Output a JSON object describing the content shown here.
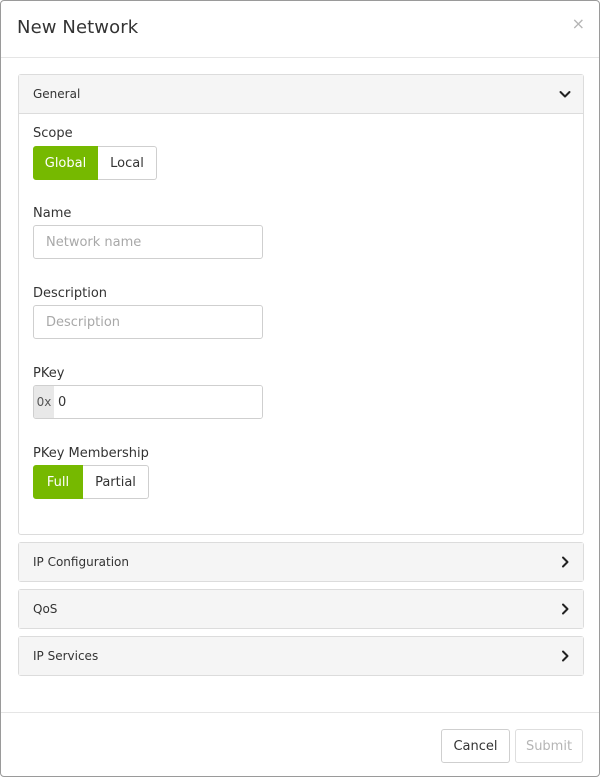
{
  "dialog": {
    "title": "New Network",
    "close_symbol": "×"
  },
  "general": {
    "title": "General",
    "expanded": true,
    "scope": {
      "label": "Scope",
      "options": [
        "Global",
        "Local"
      ],
      "selected": "Global"
    },
    "name": {
      "label": "Name",
      "value": "",
      "placeholder": "Network name"
    },
    "description": {
      "label": "Description",
      "value": "",
      "placeholder": "Description"
    },
    "pkey": {
      "label": "PKey",
      "prefix": "0x",
      "value": "0"
    },
    "pkey_membership": {
      "label": "PKey Membership",
      "options": [
        "Full",
        "Partial"
      ],
      "selected": "Full"
    }
  },
  "sections": [
    {
      "title": "IP Configuration",
      "expanded": false
    },
    {
      "title": "QoS",
      "expanded": false
    },
    {
      "title": "IP Services",
      "expanded": false
    }
  ],
  "footer": {
    "cancel_label": "Cancel",
    "submit_label": "Submit",
    "submit_disabled": true
  },
  "colors": {
    "accent": "#76b900",
    "panel_heading_bg": "#f5f5f5",
    "border": "#dcdcdc"
  },
  "icons": {
    "close": "close-icon",
    "expanded": "chevron-down-icon",
    "collapsed": "chevron-right-icon"
  }
}
